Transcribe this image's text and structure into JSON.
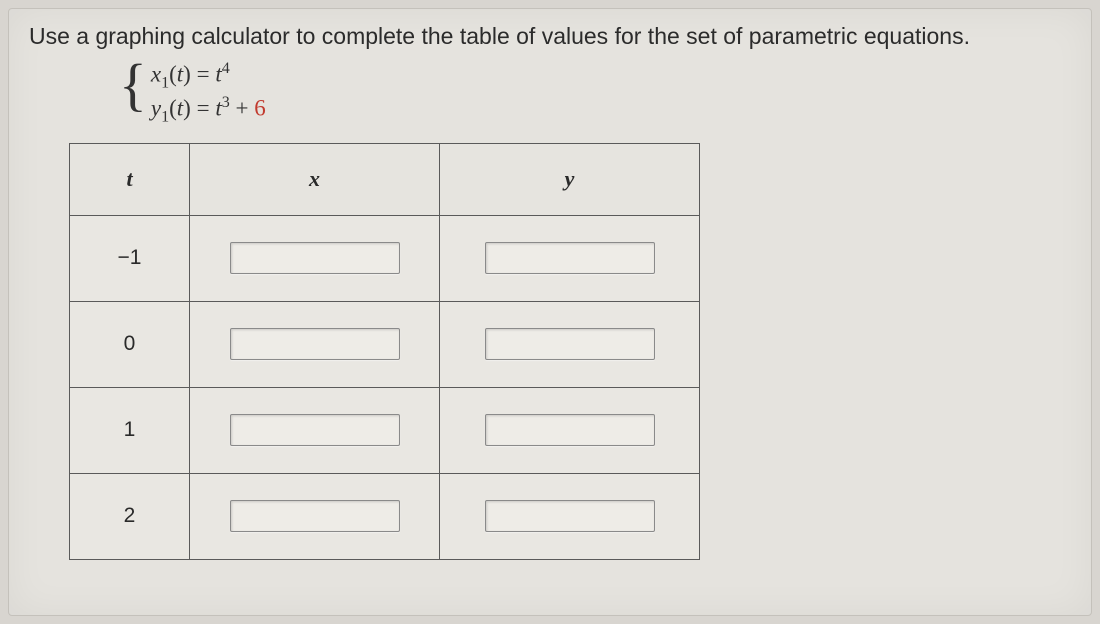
{
  "instruction": "Use a graphing calculator to complete the table of values for the set of parametric equations.",
  "equations": {
    "line1": {
      "lhs_var": "x",
      "lhs_sub": "1",
      "lhs_arg": "t",
      "eq": " = ",
      "rhs_var": "t",
      "rhs_sup": "4",
      "rhs_tail": ""
    },
    "line2": {
      "lhs_var": "y",
      "lhs_sub": "1",
      "lhs_arg": "t",
      "eq": " = ",
      "rhs_var": "t",
      "rhs_sup": "3",
      "rhs_tail_prefix": " + ",
      "rhs_const": "6"
    }
  },
  "table": {
    "headers": {
      "t": "t",
      "x": "x",
      "y": "y"
    },
    "rows": [
      {
        "t": "−1",
        "x": "",
        "y": ""
      },
      {
        "t": "0",
        "x": "",
        "y": ""
      },
      {
        "t": "1",
        "x": "",
        "y": ""
      },
      {
        "t": "2",
        "x": "",
        "y": ""
      }
    ]
  }
}
